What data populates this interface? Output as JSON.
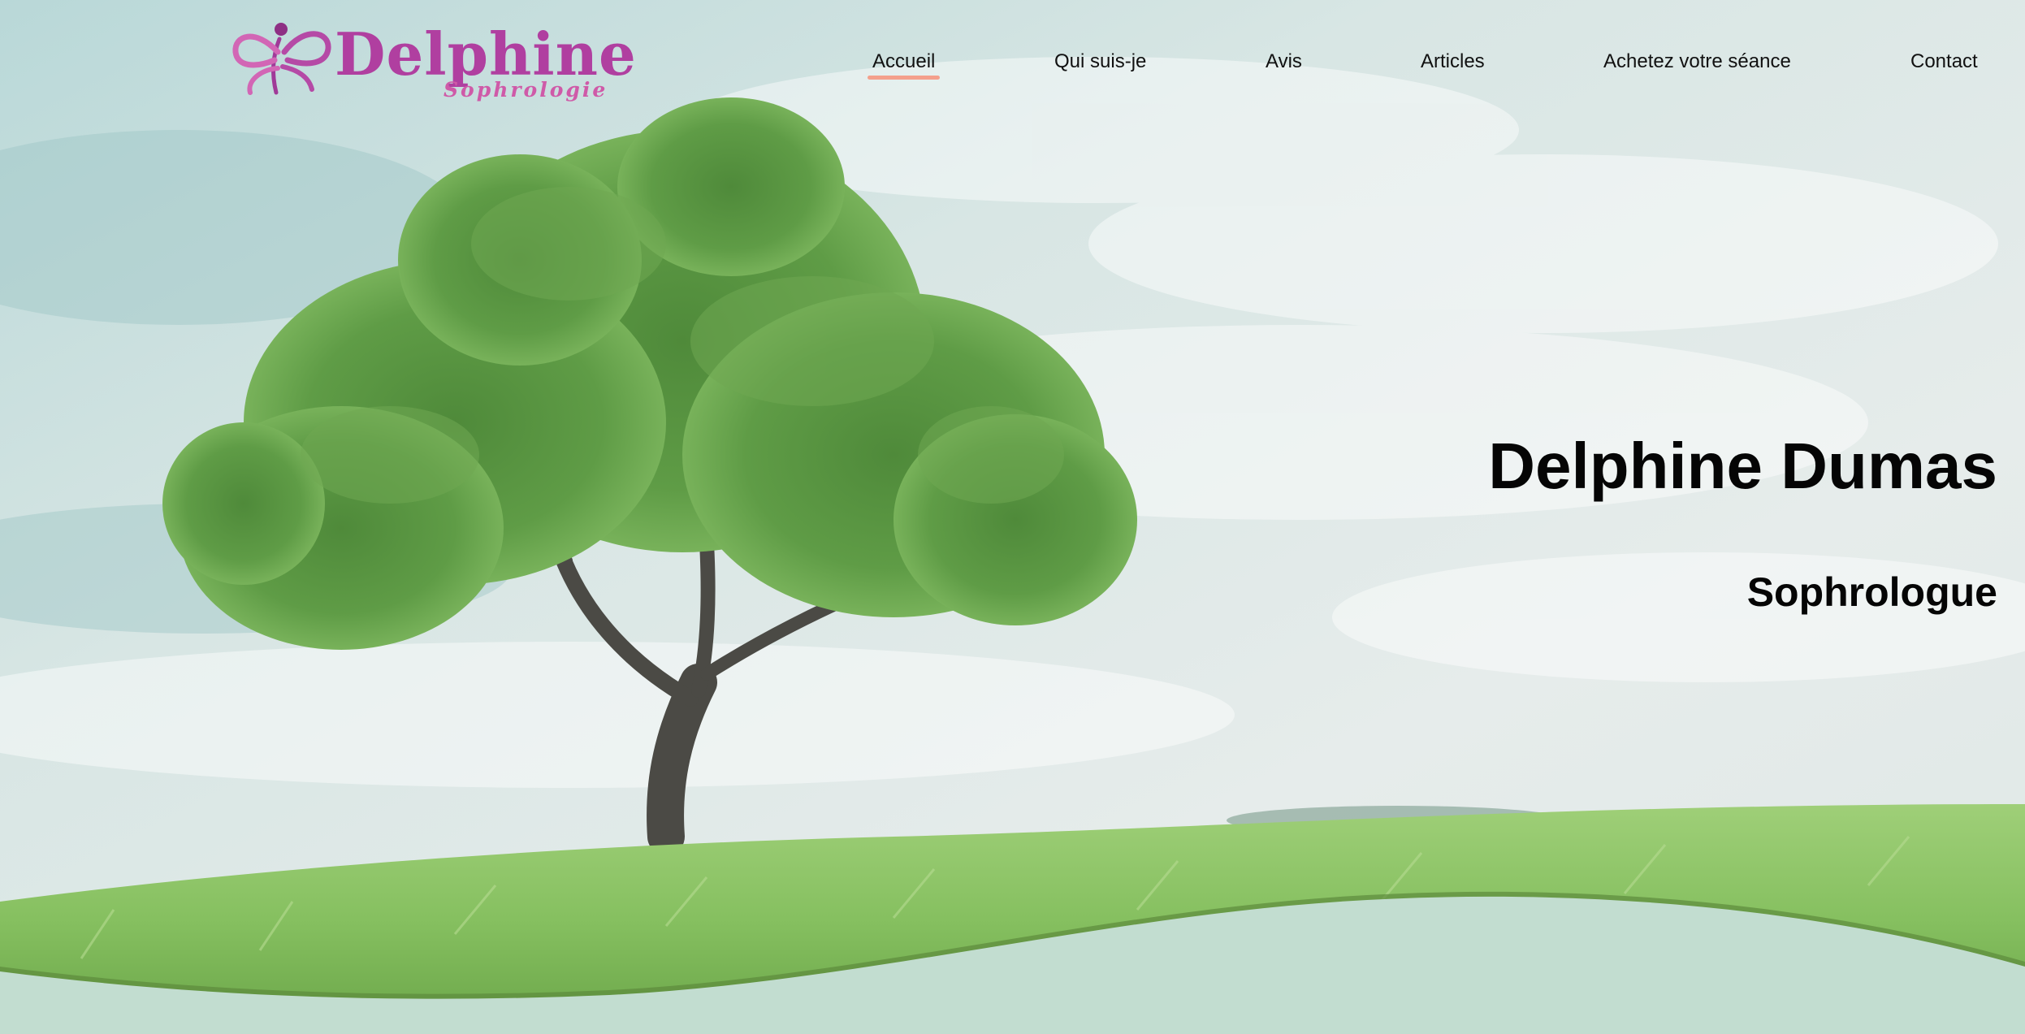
{
  "brand": {
    "name": "Delphine",
    "tagline": "Sophrologie",
    "color_primary": "#b03fa0",
    "color_secondary": "#cf5aa8"
  },
  "nav": {
    "items": [
      {
        "label": "Accueil",
        "active": true
      },
      {
        "label": "Qui suis-je",
        "active": false
      },
      {
        "label": "Avis",
        "active": false
      },
      {
        "label": "Articles",
        "active": false
      },
      {
        "label": "Achetez votre séance",
        "active": false
      },
      {
        "label": "Contact",
        "active": false
      }
    ],
    "active_underline_color": "#f4a08c"
  },
  "hero": {
    "title": "Delphine Dumas",
    "subtitle": "Sophrologue",
    "background_image": "lone-tree-in-meadow",
    "wave_color": "#c2ddd0"
  }
}
